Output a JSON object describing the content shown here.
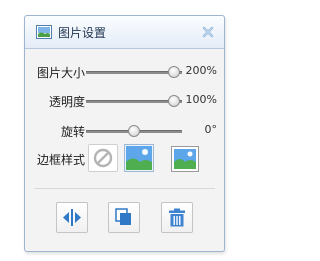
{
  "dialog": {
    "title": "图片设置",
    "icon": "picture-icon",
    "close_icon": "close-icon"
  },
  "sliders": [
    {
      "label": "图片大小",
      "value_text": "200%",
      "level": 0.92
    },
    {
      "label": "透明度",
      "value_text": "100%",
      "level": 0.92
    },
    {
      "label": "旋转",
      "value_text": "0°",
      "level": 0.5
    }
  ],
  "border_style": {
    "label": "边框样式",
    "options": [
      "no-border-icon",
      "plain-image-icon",
      "framed-image-icon"
    ]
  },
  "actions": [
    "flip-horizontal-icon",
    "copy-icon",
    "delete-icon"
  ],
  "colors": {
    "title_gradient_top": "#fbfdff",
    "title_gradient_bottom": "#e4ecf7",
    "accent_blue": "#2f79c7",
    "delete_blue": "#3d83d1"
  }
}
